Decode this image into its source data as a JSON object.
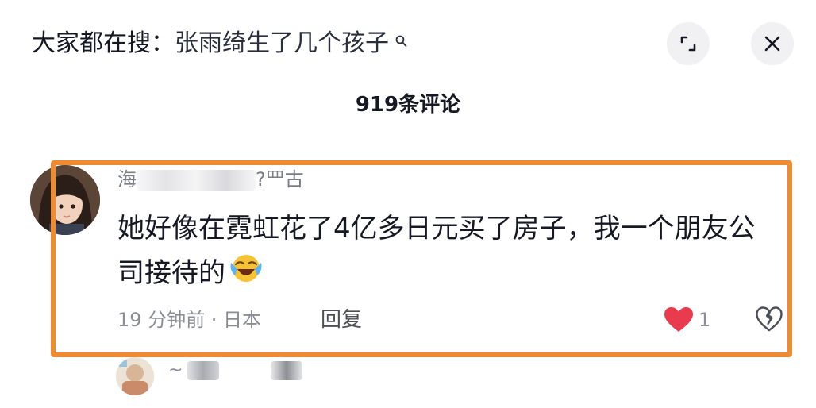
{
  "header": {
    "search_prefix": "大家都在搜：",
    "search_query": "张雨绮生了几个孩子",
    "search_icon_glyph": "⚲"
  },
  "comments_count_label": "919条评论",
  "comment": {
    "username_visible_start": "海",
    "username_visible_end": "?罒古",
    "text": "她好像在霓虹花了4亿多日元买了房子，我一个朋友公司接待的",
    "emoji_name": "loudly-crying-laughing-emoji",
    "time_location": "19 分钟前 · 日本",
    "reply_label": "回复",
    "like_count": "1",
    "liked": true
  },
  "next_comment": {
    "username_fragment": "~"
  },
  "colors": {
    "highlight_border": "#ef8c32",
    "heart": "#ea3b4e",
    "primary_text": "#161823",
    "secondary_text": "#8a8d94"
  }
}
